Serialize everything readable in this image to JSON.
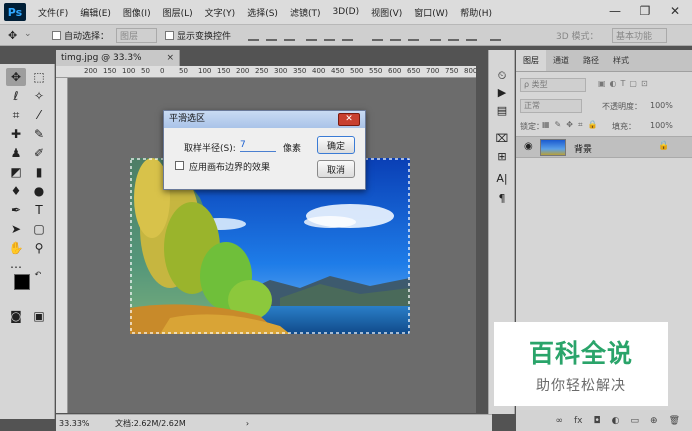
{
  "app": {
    "logo": "Ps"
  },
  "menu": [
    "文件(F)",
    "编辑(E)",
    "图像(I)",
    "图层(L)",
    "文字(Y)",
    "选择(S)",
    "滤镜(T)",
    "3D(D)",
    "视图(V)",
    "窗口(W)",
    "帮助(H)"
  ],
  "window_controls": {
    "minimize": "—",
    "restore": "❐",
    "close": "✕"
  },
  "options_bar": {
    "auto_select_label": "自动选择：",
    "auto_select_value": "图层",
    "show_transform_label": "显示变换控件",
    "mode_3d_label": "3D 模式：",
    "workspace": "基本功能"
  },
  "document": {
    "tab_title": "timg.jpg @ 33.3%(RGB/8#)",
    "tab_close": "×",
    "ruler_ticks": [
      "200",
      "150",
      "100",
      "50",
      "0",
      "50",
      "100",
      "150",
      "200",
      "250",
      "300",
      "350",
      "400",
      "450",
      "500",
      "550",
      "600",
      "650",
      "700",
      "750",
      "800",
      "850",
      "900",
      "950"
    ]
  },
  "status_bar": {
    "zoom": "33.33%",
    "doc_info": "文档:2.62M/2.62M",
    "arrow": "›"
  },
  "dialog": {
    "title": "平滑选区",
    "close": "✕",
    "radius_label": "取样半径(S):",
    "radius_value": "7",
    "unit": "像素",
    "apply_edge_label": "应用画布边界的效果",
    "ok": "确定",
    "cancel": "取消"
  },
  "layers_panel": {
    "tabs": [
      "图层",
      "通道",
      "路径",
      "样式"
    ],
    "kind_filter": "ρ 类型",
    "blend_mode": "正常",
    "opacity_label": "不透明度：",
    "opacity_value": "100%",
    "lock_label": "锁定：",
    "fill_label": "填充：",
    "fill_value": "100%",
    "layer_name": "背景"
  },
  "watermark": {
    "title": "百科全说",
    "subtitle": "助你轻松解决"
  },
  "colors": {
    "foreground": "#000000",
    "background": "#ffffff",
    "watermark_green": "#2aa46a"
  }
}
